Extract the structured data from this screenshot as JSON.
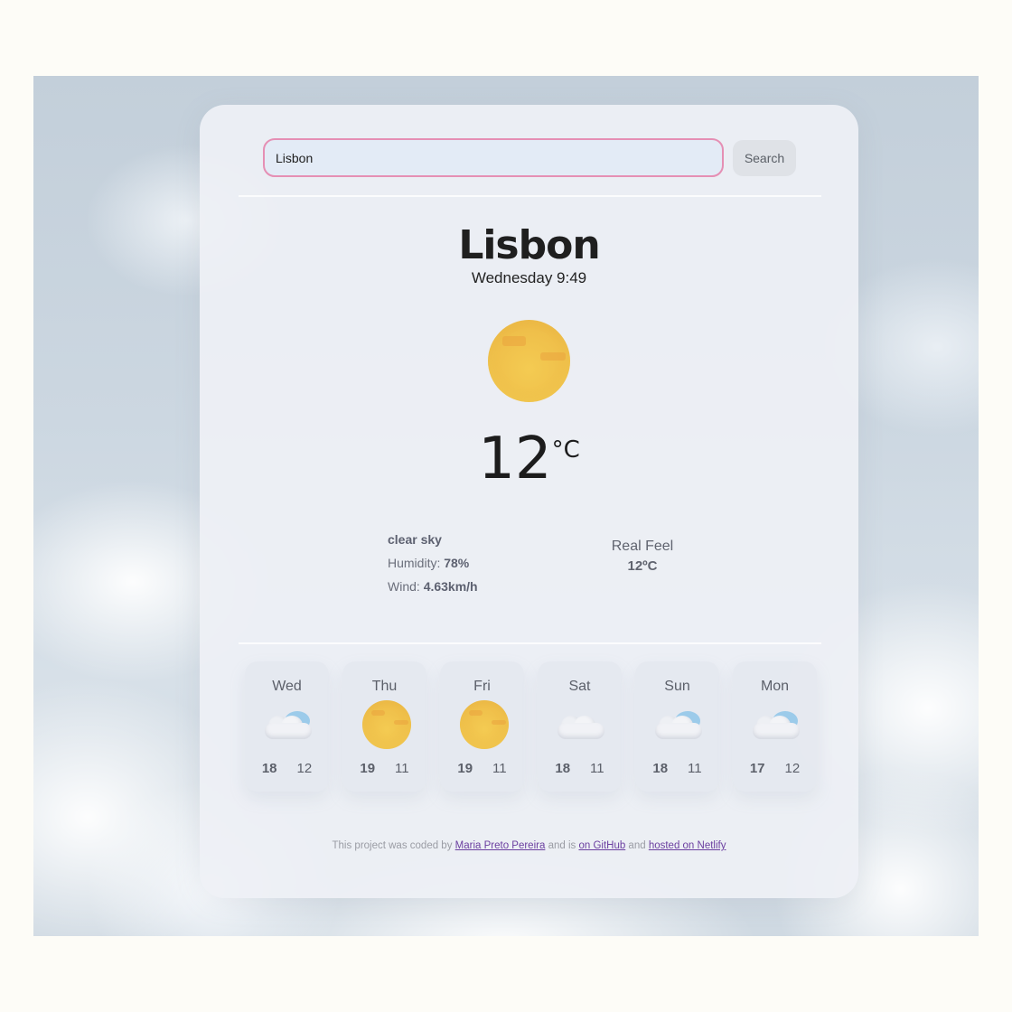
{
  "search": {
    "value": "Lisbon",
    "button_label": "Search"
  },
  "weather": {
    "city": "Lisbon",
    "datetime": "Wednesday 9:49",
    "icon": "sun-icon",
    "temperature": "12",
    "unit": "°C",
    "description": "clear sky",
    "humidity_label": "Humidity: ",
    "humidity_value": "78%",
    "wind_label": "Wind: ",
    "wind_value": "4.63km/h",
    "realfeel_label": "Real Feel",
    "realfeel_value": "12ºC"
  },
  "forecast": [
    {
      "day": "Wed",
      "icon": "partly-cloudy-icon",
      "high": "18",
      "low": "12"
    },
    {
      "day": "Thu",
      "icon": "sun-icon",
      "high": "19",
      "low": "11"
    },
    {
      "day": "Fri",
      "icon": "sun-icon",
      "high": "19",
      "low": "11"
    },
    {
      "day": "Sat",
      "icon": "cloud-icon",
      "high": "18",
      "low": "11"
    },
    {
      "day": "Sun",
      "icon": "partly-cloudy-icon",
      "high": "18",
      "low": "11"
    },
    {
      "day": "Mon",
      "icon": "partly-cloudy-icon",
      "high": "17",
      "low": "12"
    }
  ],
  "footer": {
    "text_1": "This project was coded by ",
    "author_link": "Maria Preto Pereira",
    "text_2": " and is ",
    "github_link": "on GitHub",
    "text_3": " and ",
    "netlify_link": "hosted on Netlify"
  },
  "colors": {
    "accent_border": "#e58fb4",
    "link": "#6b3fa0",
    "sun": "#f2c34c"
  }
}
